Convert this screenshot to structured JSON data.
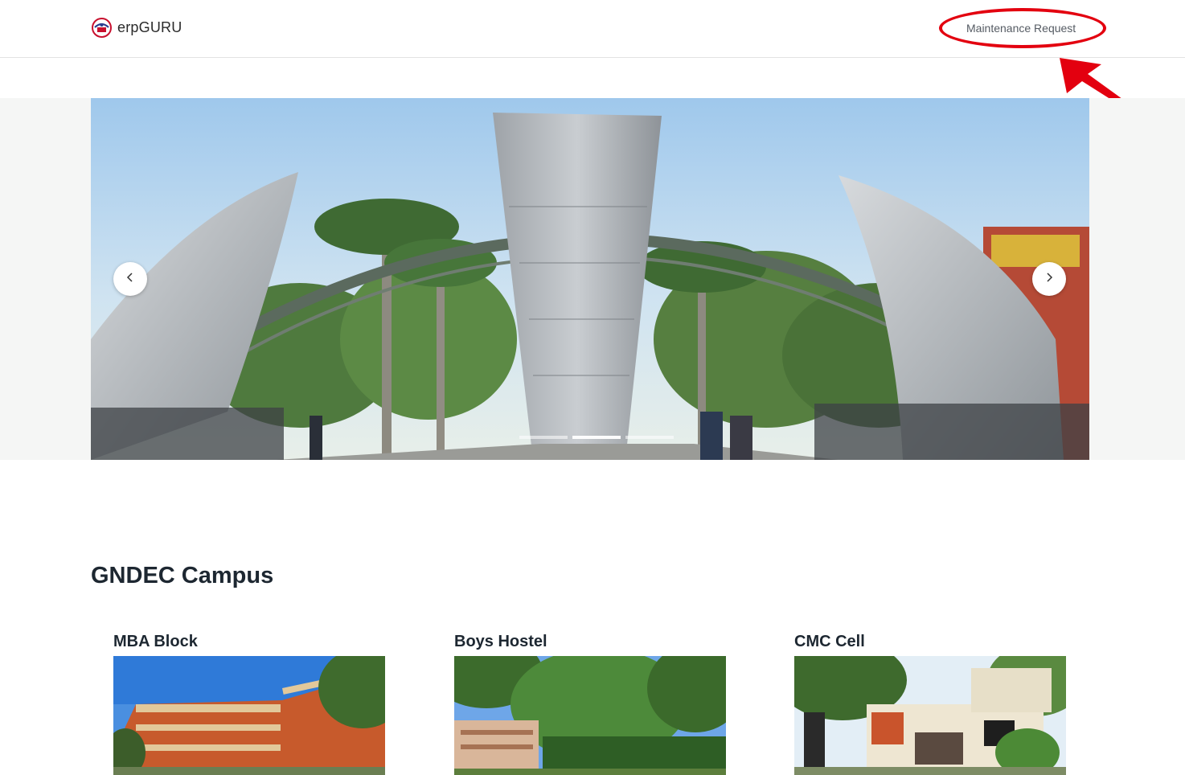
{
  "navbar": {
    "brand_text": "erpGURU",
    "logo_icon": "erp-guru-logo-icon",
    "links": [
      {
        "label": "Maintenance Request"
      }
    ],
    "annotation_color": "#e3000f"
  },
  "hero": {
    "slide_count": 3,
    "active_slide": 1,
    "prev_icon": "chevron-left-icon",
    "next_icon": "chevron-right-icon"
  },
  "campus": {
    "title": "GNDEC Campus",
    "cards": [
      {
        "title": "MBA Block"
      },
      {
        "title": "Boys Hostel"
      },
      {
        "title": "CMC Cell"
      }
    ]
  }
}
